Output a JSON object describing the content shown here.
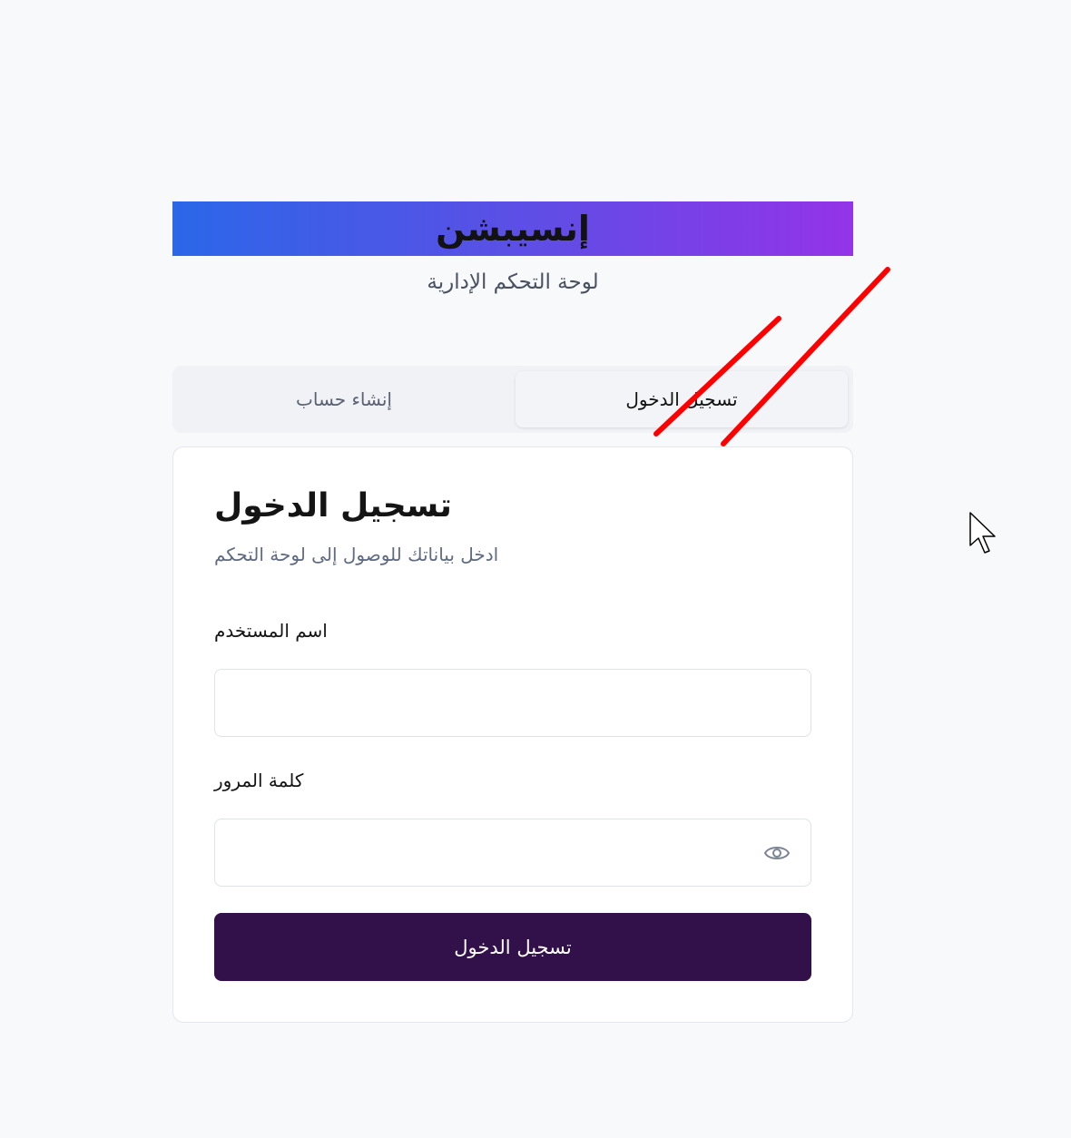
{
  "brand": {
    "name": "إنسيبشن",
    "subtitle": "لوحة التحكم الإدارية"
  },
  "tabs": [
    {
      "label": "تسجيل الدخول",
      "active": true
    },
    {
      "label": "إنشاء حساب",
      "active": false
    }
  ],
  "login": {
    "title": "تسجيل الدخول",
    "description": "ادخل بياناتك للوصول إلى لوحة التحكم",
    "username_label": "اسم المستخدم",
    "username_value": "",
    "password_label": "كلمة المرور",
    "password_value": "",
    "password_toggle_icon": "eye-icon",
    "submit_label": "تسجيل الدخول"
  },
  "colors": {
    "gradient_start": "#2b67e8",
    "gradient_end": "#9433e8",
    "submit_button": "#32114a",
    "annotation_stroke": "#ff0000"
  }
}
